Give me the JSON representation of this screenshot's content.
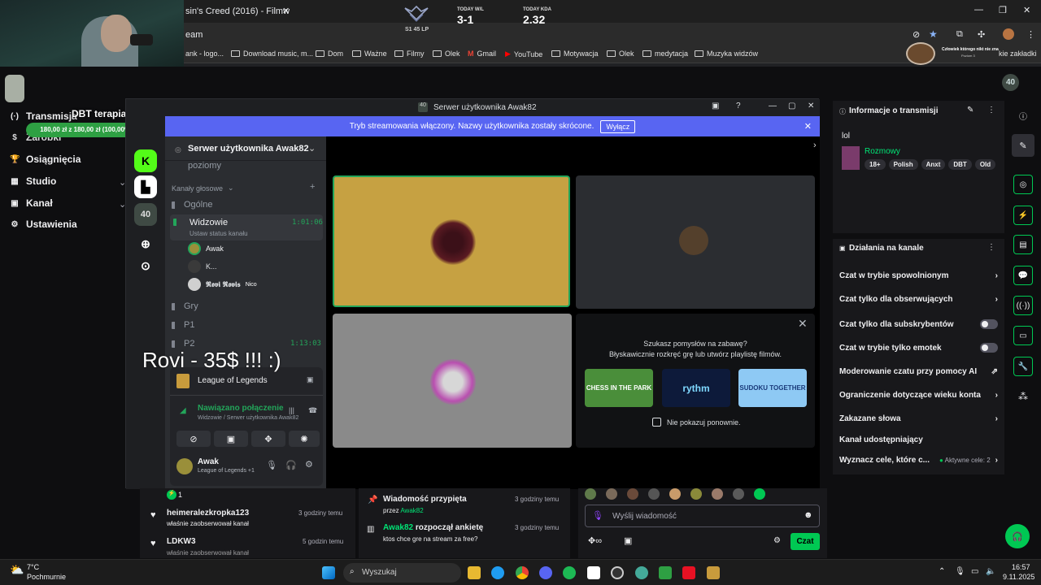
{
  "browser": {
    "tab_title": "sin's Creed (2016) - Filmw",
    "address_fragment": "eam",
    "bookmarks": [
      "ank - logo...",
      "Download music, m...",
      "Dom",
      "Ważne",
      "Filmy",
      "Olek",
      "Gmail",
      "YouTube",
      "Motywacja",
      "Olek",
      "medytacja",
      "Muzyka widzów"
    ],
    "other_bookmarks": "kie zakładki"
  },
  "overlay": {
    "rank_lp": "S1 45 LP",
    "today_wl_label": "TODAY W/L",
    "today_wl": "3-1",
    "today_kda_label": "TODAY KDA",
    "today_kda": "2.32",
    "goal_title": "DBT terapia",
    "goal_progress": "180,00 zł z 180,00 zł (100,00%)",
    "goal_fraction": 1.0,
    "donation_text": "Rovi - 35$ !!! :)",
    "sub_badge_text": "Człowiek którego nikt nie zna",
    "sub_badge_sub": "Poziom 3"
  },
  "twitch_nav": {
    "items": [
      "Transmisja",
      "Zarobki",
      "Osiągnięcia",
      "Studio",
      "Kanał",
      "Ustawienia"
    ]
  },
  "discord": {
    "window_title": "Serwer użytkownika Awak82",
    "banner_text": "Tryb streamowania włączony. Nazwy użytkownika zostały skrócone.",
    "banner_button": "Wyłącz",
    "server_name": "Serwer użytkownika Awak82",
    "partial_channel": "poziomy",
    "voice_category": "Kanały głosowe",
    "channels": {
      "general": "Ogólne",
      "widzowie": "Widzowie",
      "widzowie_timer": "1:01:06",
      "status_hint": "Ustaw status kanału",
      "users": [
        "Awak",
        "K...",
        "𝕽𝖔𝖛𝖎 𝕽𝖔𝖛𝖎𝖘"
      ],
      "nico": "Nico",
      "gry": "Gry",
      "p1": "P1",
      "p2": "P2",
      "p2_timer": "1:13:03"
    },
    "activity": "League of Legends",
    "connection_status": "Nawiązano połączenie",
    "connection_path": "Widzowie / Serwer użytkownika Awak82",
    "user_name": "Awak",
    "user_activity": "League of Legends +1",
    "activity_prompt_title": "Szukasz pomysłów na zabawę?",
    "activity_prompt_sub": "Błyskawicznie rozkręć grę lub utwórz playlistę filmów.",
    "activity_cards": [
      "CHESS IN THE PARK",
      "rythm",
      "SUDOKU TOGETHER"
    ],
    "dont_show": "Nie pokazuj ponownie."
  },
  "feed": {
    "count_badge": "1",
    "items": [
      {
        "user": "heimeralezkropka123",
        "action": "właśnie zaobserwował kanał",
        "time": "3 godziny temu"
      },
      {
        "user": "LDKW3",
        "action": "właśnie zaobserwował kanał",
        "time": "5 godzin temu"
      }
    ],
    "pinned_title": "Wiadomość przypięta",
    "pinned_by_prefix": "przez",
    "pinned_by": "Awak82",
    "pinned_time": "3 godziny temu",
    "poll_user": "Awak82",
    "poll_action": "rozpoczął ankietę",
    "poll_time": "3 godziny temu",
    "poll_question": "ktos chce gre na stream za free?"
  },
  "chat": {
    "placeholder": "Wyślij wiadomość",
    "send_label": "Czat"
  },
  "stream_info": {
    "title": "Informacje o transmisji",
    "stream_title": "lol",
    "category": "Rozmowy",
    "tags": [
      "18+",
      "Polish",
      "Anxt",
      "DBT",
      "Old"
    ]
  },
  "channel_actions": {
    "title": "Działania na kanale",
    "items": [
      {
        "label": "Czat w trybie spowolnionym",
        "kind": "chevron"
      },
      {
        "label": "Czat tylko dla obserwujących",
        "kind": "chevron"
      },
      {
        "label": "Czat tylko dla subskrybentów",
        "kind": "toggle"
      },
      {
        "label": "Czat w trybie tylko emotek",
        "kind": "toggle"
      },
      {
        "label": "Moderowanie czatu przy pomocy AI",
        "kind": "external"
      },
      {
        "label": "Ograniczenie dotyczące wieku konta",
        "kind": "chevron"
      },
      {
        "label": "Zakazane słowa",
        "kind": "chevron"
      },
      {
        "label": "Kanał udostępniający",
        "kind": "none"
      },
      {
        "label": "Wyznacz cele, które c...",
        "kind": "chevron",
        "extra": "Aktywne cele: 2"
      }
    ]
  },
  "taskbar": {
    "weather_temp": "7°C",
    "weather_desc": "Pochmurnie",
    "search_placeholder": "Wyszukaj",
    "time": "16:57",
    "date": "9.11.2025"
  },
  "colors": {
    "twitch_purple": "#9146ff",
    "discord_blurple": "#5865f2",
    "twitch_green": "#00c853",
    "goal_green": "#2ea043"
  }
}
